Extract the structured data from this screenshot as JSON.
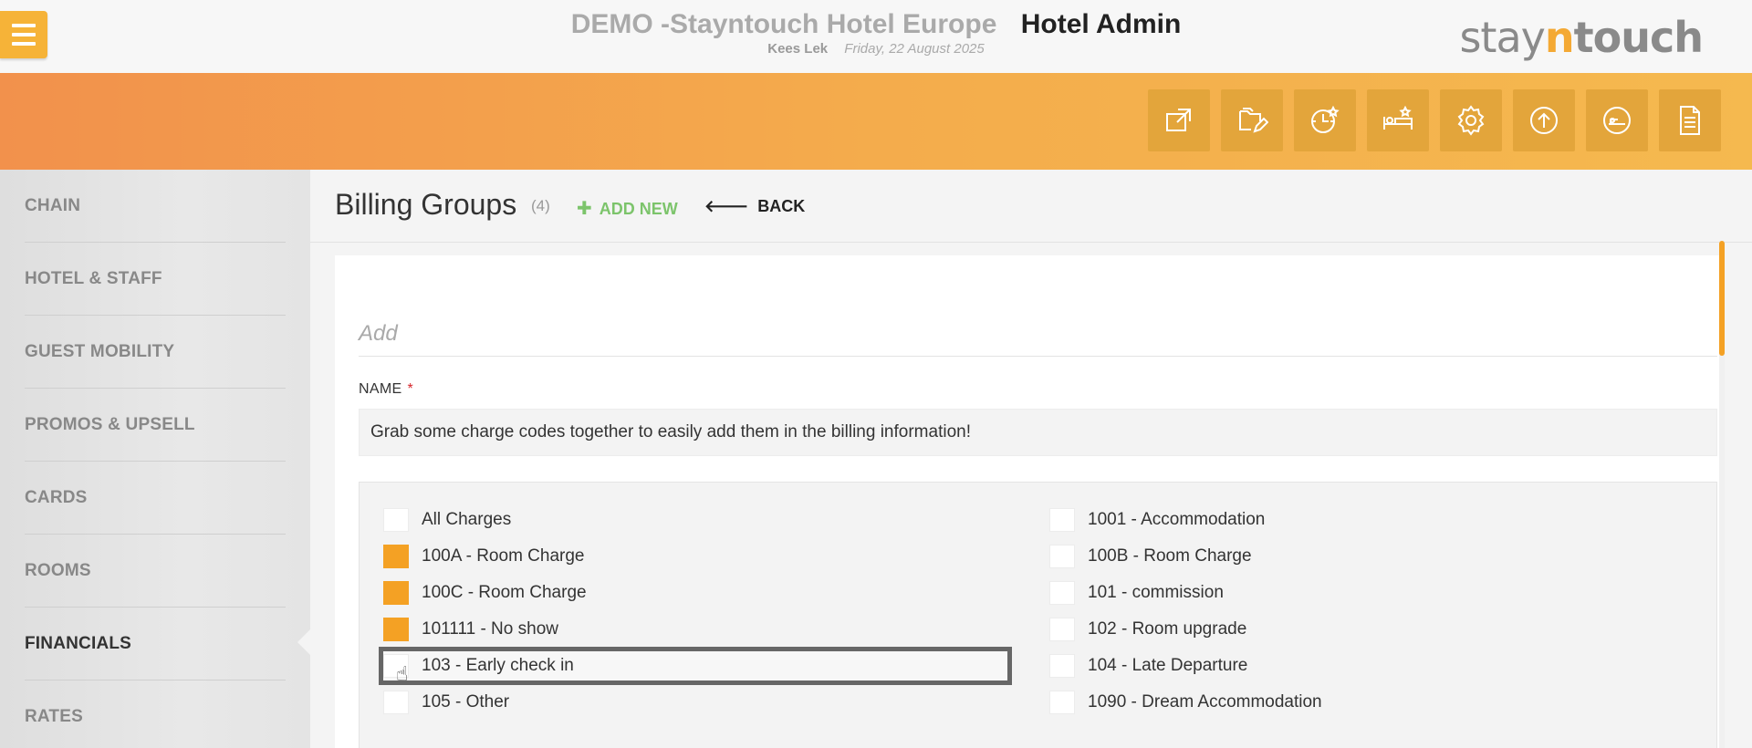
{
  "header": {
    "hotel_name": "DEMO -Stayntouch Hotel Europe",
    "admin_title": "Hotel Admin",
    "user": "Kees Lek",
    "date": "Friday, 22 August 2025",
    "logo": {
      "part1": "stay",
      "part2": "n",
      "part3": "touch"
    }
  },
  "banner": {
    "icons": [
      "external-link-icon",
      "folder-edit-icon",
      "clock-star-icon",
      "bed-star-icon",
      "gear-icon",
      "upload-icon",
      "guest-icon",
      "document-icon"
    ]
  },
  "sidebar": {
    "items": [
      {
        "label": "CHAIN"
      },
      {
        "label": "HOTEL & STAFF"
      },
      {
        "label": "GUEST MOBILITY"
      },
      {
        "label": "PROMOS & UPSELL"
      },
      {
        "label": "CARDS"
      },
      {
        "label": "ROOMS"
      },
      {
        "label": "FINANCIALS"
      },
      {
        "label": "RATES"
      }
    ],
    "active": "FINANCIALS"
  },
  "page": {
    "title": "Billing Groups",
    "count": "(4)",
    "add_new": "ADD NEW",
    "back": "BACK"
  },
  "form": {
    "panel_title": "Add",
    "name_label": "NAME",
    "required_mark": "*",
    "name_value": "Grab some charge codes together to easily add them in the billing information!"
  },
  "charges": {
    "left": [
      {
        "label": "All Charges",
        "checked": false
      },
      {
        "label": "100A - Room Charge",
        "checked": true
      },
      {
        "label": "100C - Room Charge",
        "checked": true
      },
      {
        "label": "101111 - No show",
        "checked": true
      },
      {
        "label": "103 - Early check in",
        "checked": false
      },
      {
        "label": "105 - Other",
        "checked": false
      }
    ],
    "right": [
      {
        "label": "1001 - Accommodation",
        "checked": false
      },
      {
        "label": "100B - Room Charge",
        "checked": false
      },
      {
        "label": "101 - commission",
        "checked": false
      },
      {
        "label": "102 - Room upgrade",
        "checked": false
      },
      {
        "label": "104 - Late Departure",
        "checked": false
      },
      {
        "label": "1090 - Dream Accommodation",
        "checked": false
      }
    ]
  },
  "colors": {
    "accent": "#f4a124",
    "green": "#7cc46b",
    "required": "#d6262c"
  }
}
